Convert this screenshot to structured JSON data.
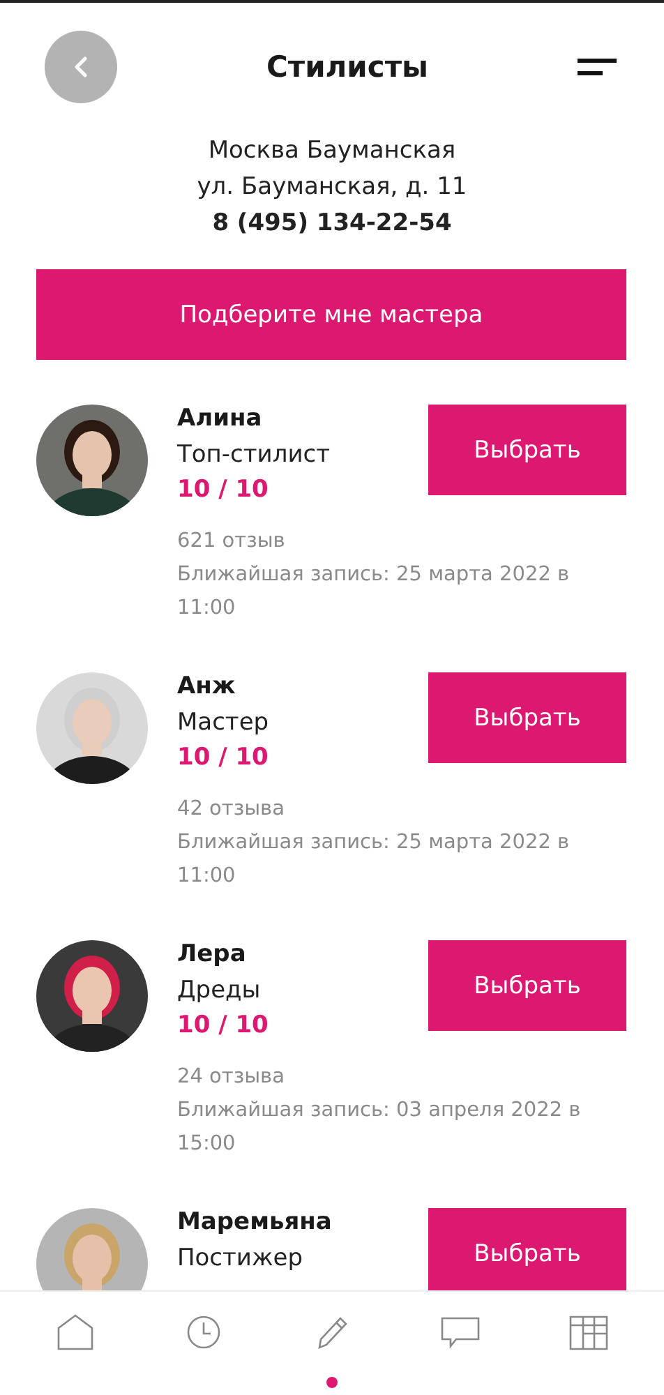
{
  "header": {
    "title": "Стилисты"
  },
  "salon": {
    "name": "Москва Бауманская",
    "address": "ул. Бауманская, д. 11",
    "phone": "8 (495) 134-22-54"
  },
  "match_button": "Подберите мне мастера",
  "stylists": [
    {
      "name": "Алина",
      "role": "Топ-стилист",
      "rating": "10 / 10",
      "reviews": "621 отзыв",
      "next_slot": "Ближайшая запись: 25 марта 2022 в 11:00",
      "button": "Выбрать"
    },
    {
      "name": "Анж",
      "role": "Мастер",
      "rating": "10 / 10",
      "reviews": "42 отзыва",
      "next_slot": "Ближайшая запись: 25 марта 2022 в 11:00",
      "button": "Выбрать"
    },
    {
      "name": "Лера",
      "role": "Дреды",
      "rating": "10 / 10",
      "reviews": "24 отзыва",
      "next_slot": "Ближайшая запись: 03 апреля 2022 в 15:00",
      "button": "Выбрать"
    },
    {
      "name": "Маремьяна",
      "role": "Постижер",
      "button": "Выбрать"
    }
  ],
  "bottom_nav": [
    {
      "kind": "home",
      "selected": false
    },
    {
      "kind": "history",
      "selected": false
    },
    {
      "kind": "booking",
      "selected": true
    },
    {
      "kind": "chat",
      "selected": false
    },
    {
      "kind": "catalog",
      "selected": false
    }
  ]
}
